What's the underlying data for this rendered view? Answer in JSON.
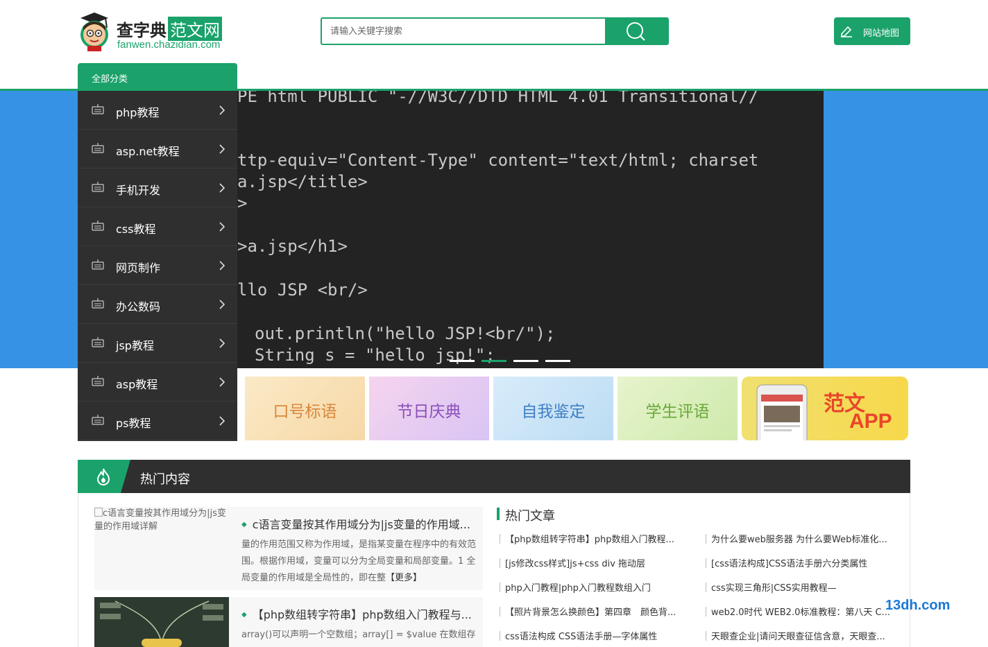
{
  "header": {
    "logo_title": "查字典",
    "logo_highlight": "范文网",
    "logo_sub": "fanwen.chazidian.com",
    "search_placeholder": "请输入关键字搜索",
    "map_label": "网站地图"
  },
  "category": {
    "tab_label": "全部分类",
    "items": [
      {
        "label": "php教程"
      },
      {
        "label": "asp.net教程"
      },
      {
        "label": "手机开发"
      },
      {
        "label": "css教程"
      },
      {
        "label": "网页制作"
      },
      {
        "label": "办公数码"
      },
      {
        "label": "jsp教程"
      },
      {
        "label": "asp教程"
      },
      {
        "label": "ps教程"
      }
    ]
  },
  "banner": {
    "code_lines": [
      "PE html PUBLIC \"-//W3C//DTD HTML 4.01 Transitional//",
      "ttp-equiv=\"Content-Type\" content=\"text/html; charset",
      "a.jsp</title>",
      ">",
      ">a.jsp</h1>",
      "llo JSP <br/>",
      "out.println(\"hello JSP!<br/\");",
      "String s = \"hello jsp!\";"
    ],
    "slides_total": 4,
    "active_slide": 2
  },
  "tiles": [
    {
      "label": "口号标语",
      "color": "#d9873c"
    },
    {
      "label": "节日庆典",
      "color": "#8a4fb8"
    },
    {
      "label": "自我鉴定",
      "color": "#3f7fc4"
    },
    {
      "label": "学生评语",
      "color": "#6aa83a"
    }
  ],
  "app_tile": {
    "title": "范文",
    "subtitle": "APP"
  },
  "hot": {
    "title": "热门内容",
    "articles": [
      {
        "img_alt": "c语言变量按其作用域分为|js变量的作用域详解",
        "title": "c语言变量按其作用域分为|js变量的作用域...",
        "desc": "量的作用范围又称为作用域，是指某变量在程序中的有效范围。根据作用域，变量可以分为全局变量和局部变量。1 全局变量的作用域是全局性的，即在整",
        "more": "【更多】"
      },
      {
        "title": "【php数组转字符串】php数组入门教程与...",
        "desc": "array()可以声明一个空数组；array[] = $value 在数组存"
      }
    ],
    "side_title": "热门文章",
    "links": [
      "【php数组转字符串】php数组入门教程...",
      "为什么要web服务器 为什么要Web标准化...",
      "[js修改css样式]js+css div 拖动层",
      "[css语法构成]CSS语法手册六分类属性",
      "php入门教程|php入门教程数组入门",
      "css实现三角形|CSS实用教程—",
      "【照片背景怎么换颜色】第四章　颜色背...",
      "web2.0时代 WEB2.0标准教程：第八天 C...",
      "css语法构成 CSS语法手册—字体属性",
      "天眼查企业|请问天眼查征信含意，天眼查..."
    ]
  },
  "watermark": "13dh.com"
}
